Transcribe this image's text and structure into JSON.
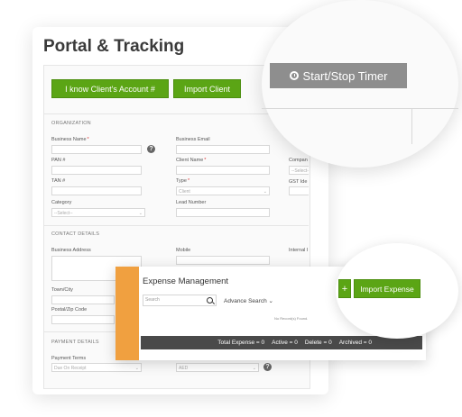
{
  "page": {
    "title": "Portal & Tracking"
  },
  "toolbar": {
    "know_account_label": "I know Client's Account #",
    "import_client_label": "Import Client",
    "timer_label": "Start/Stop Timer"
  },
  "organization": {
    "section_label": "ORGANIZATION",
    "business_name": "Business Name",
    "pan": "PAN #",
    "tan": "TAN #",
    "category": "Category",
    "category_value": "--Select--",
    "business_email": "Business Email",
    "client_name": "Client Name",
    "type": "Type",
    "type_value": "Client",
    "lead_number": "Lead Number",
    "company_partial": "Compan",
    "company_value": "--Select--",
    "gst_partial": "GST Ide",
    "right_partial_select": "--Select--"
  },
  "contact": {
    "section_label": "CONTACT DETAILS",
    "business_address": "Business Address",
    "mobile": "Mobile",
    "internal_partial": "Internal I",
    "town_city": "Town/City",
    "postal": "Postal/Zip Code"
  },
  "payment": {
    "section_label": "PAYMENT DETAILS",
    "terms": "Payment Terms",
    "terms_value": "Due On Receipt",
    "currency_value": "AED"
  },
  "expense": {
    "title": "Expense Management",
    "search_placeholder": "Search",
    "advance_search": "Advance Search",
    "add_label": "+",
    "import_label": "Import Expense",
    "no_records": "No Record(s) Found.",
    "summary": {
      "total": "Total Expense = 0",
      "active": "Active = 0",
      "delete": "Delete = 0",
      "archived": "Archived = 0"
    }
  },
  "colors": {
    "green": "#5ba515",
    "timer": "#8e8e8e",
    "accent_orange": "#f0a040",
    "bar": "#4a4a4a"
  },
  "icons": [
    "help-icon",
    "clock-icon",
    "search-icon",
    "chevron-down-icon"
  ]
}
